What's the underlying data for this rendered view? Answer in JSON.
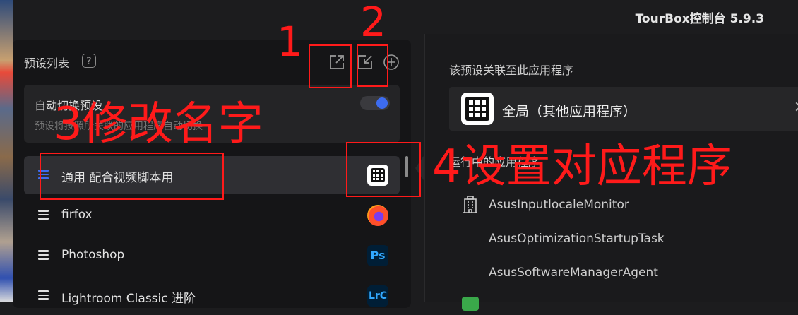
{
  "app": {
    "title": "TourBox控制台 5.9.3"
  },
  "presets_panel": {
    "title": "预设列表",
    "help_glyph": "?",
    "auto_switch": {
      "title": "自动切换预设",
      "description": "预设将按照所关联的应用程序自动切换",
      "enabled": true
    },
    "items": [
      {
        "label": "通用 配合视频脚本用",
        "icon": "grid-icon",
        "active": true
      },
      {
        "label": "firfox",
        "icon": "firefox-icon",
        "active": false
      },
      {
        "label": "Photoshop",
        "icon": "ps-icon",
        "icon_text": "Ps",
        "active": false
      },
      {
        "label": "Lightroom Classic 进阶",
        "icon": "lrc-icon",
        "icon_text": "LrC",
        "active": false
      }
    ]
  },
  "association_panel": {
    "label": "该预设关联至此应用程序",
    "selected_app": "全局（其他应用程序）",
    "close_glyph": "×",
    "running_label": "运行中的应用程序",
    "processes": [
      {
        "name": "AsusInputlocaleMonitor",
        "icon": "building-icon"
      },
      {
        "name": "AsusOptimizationStartupTask",
        "icon": ""
      },
      {
        "name": "AsusSoftwareManagerAgent",
        "icon": ""
      }
    ]
  },
  "annotations": {
    "n1": "1",
    "n2": "2",
    "n3": "3修改名字",
    "n4": "4设置对应程序",
    "color": "#ff1a1a"
  },
  "colors": {
    "accent": "#3d6cf0",
    "background": "#1c1c1e",
    "panel": "#151517"
  }
}
